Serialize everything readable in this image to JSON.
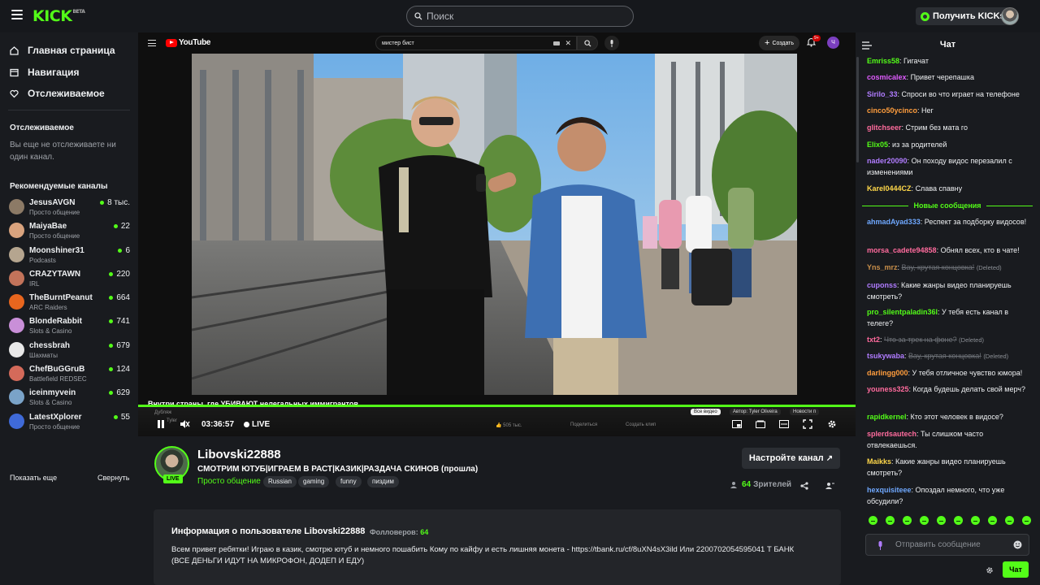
{
  "topbar": {
    "logo": "KICK",
    "logo_badge": "BETA",
    "search_placeholder": "Поиск",
    "get_kicks": "Получить KICKs"
  },
  "sidebar": {
    "nav": [
      {
        "label": "Главная страница",
        "icon": "home-icon"
      },
      {
        "label": "Навигация",
        "icon": "browse-icon"
      },
      {
        "label": "Отслеживаемое",
        "icon": "heart-icon"
      }
    ],
    "following_title": "Отслеживаемое",
    "following_empty": "Вы еще не отслеживаете ни один канал.",
    "recommended_title": "Рекомендуемые каналы",
    "channels": [
      {
        "name": "JesusAVGN",
        "category": "Просто общение",
        "viewers": "8 тыс.",
        "color": "#8c7a66"
      },
      {
        "name": "MaiyaBae",
        "category": "Просто общение",
        "viewers": "22",
        "color": "#d9a37e"
      },
      {
        "name": "Moonshiner31",
        "category": "Podcasts",
        "viewers": "6",
        "color": "#b5a58f"
      },
      {
        "name": "CRAZYTAWN",
        "category": "IRL",
        "viewers": "220",
        "color": "#c2735a"
      },
      {
        "name": "TheBurntPeanut",
        "category": "ARC Raiders",
        "viewers": "664",
        "color": "#e8661e"
      },
      {
        "name": "BlondeRabbit",
        "category": "Slots & Casino",
        "viewers": "741",
        "color": "#c98fd8"
      },
      {
        "name": "chessbrah",
        "category": "Шахматы",
        "viewers": "679",
        "color": "#e8e8e8"
      },
      {
        "name": "ChefBuGGruB",
        "category": "Battlefield REDSEC",
        "viewers": "124",
        "color": "#d46a5a"
      },
      {
        "name": "iceinmyvein",
        "category": "Slots & Casino",
        "viewers": "629",
        "color": "#7aa3c8"
      },
      {
        "name": "LatestXplorer",
        "category": "Просто общение",
        "viewers": "55",
        "color": "#3f6ad8"
      }
    ],
    "show_more": "Показать еще",
    "collapse": "Свернуть"
  },
  "youtube": {
    "logo": "YouTube",
    "search_value": "мистер бист",
    "create": "Создать",
    "notif_count": "9+",
    "avatar_letter": "Ч",
    "video_title": "Внутри страны, где УБИВАЮТ нелегальных иммигрантов..."
  },
  "player": {
    "time": "03:36:57",
    "live": "LIVE",
    "ghost_likes": "505 тыс.",
    "ghost_share": "Поделиться",
    "ghost_clip": "Создать клип",
    "ghost_dub": "Дубляж",
    "ghost_author": "Tyler",
    "chips": [
      "Все видео",
      "Автор: Tyler Oliveira",
      "Новости п"
    ]
  },
  "channel": {
    "name": "Libovski22888",
    "live_badge": "LIVE",
    "stream_title": "СМОТРИМ ЮТУБ|ИГРАЕМ В РАСТ|КАЗИК|РАЗДАЧА СКИНОВ (прошла)",
    "category": "Просто общение",
    "tags": [
      "Russian",
      "gaming",
      "funny",
      "пиздим"
    ],
    "setup_button": "Настройте канал",
    "viewers_count": "64",
    "viewers_label": "Зрителей"
  },
  "about": {
    "heading": "Информация о пользователе Libovski22888",
    "followers_label": "Фолловеров:",
    "followers_count": "64",
    "description": "Всем привет ребятки! Играю в казик, смотрю ютуб и немного пошабить Кому по кайфу и есть лишняя монета - https://tbank.ru/cf/8uXN4sX3ild Или 2200702054595041 Т БАНК (ВСЕ ДЕНЬГИ ИДУТ НА МИКРОФОН, ДОДЕП И ЕДУ)"
  },
  "chat": {
    "title": "Чат",
    "new_messages": "Новые сообщения",
    "deleted_label": "(Deleted)",
    "messages": [
      {
        "user": "Emriss58",
        "color": "#53fc18",
        "text": "Гигачат"
      },
      {
        "user": "cosmicalex",
        "color": "#e05cff",
        "text": "Привет черепашка"
      },
      {
        "user": "Sirilo_33",
        "color": "#b07cff",
        "text": "Спроси во что играет на телефоне"
      },
      {
        "user": "cinco50ycinco",
        "color": "#ff9d3d",
        "text": "Нег"
      },
      {
        "user": "glitchseer",
        "color": "#ff6b9d",
        "text": "Стрим без мата го"
      },
      {
        "user": "Elix05",
        "color": "#53fc18",
        "text": "из за родителей"
      },
      {
        "user": "nader20090",
        "color": "#b07cff",
        "text": "Он походу видос перезалил с изменениями"
      },
      {
        "user": "Karel0444CZ",
        "color": "#ffd84a",
        "text": "Слава спавну"
      },
      {
        "user": "ahmadAyad333",
        "color": "#6fa8ff",
        "text": "Респект за подборку видосов!"
      },
      {
        "user": "morsa_cadete94858",
        "color": "#ff6b9d",
        "text": "Обнял всех, кто в чате!"
      },
      {
        "user": "Yns_mrz",
        "color": "#c98f4a",
        "text": "Вау, крутая концовка!",
        "deleted": true
      },
      {
        "user": "cuponss",
        "color": "#b07cff",
        "text": "Какие жанры видео планируешь смотреть?"
      },
      {
        "user": "pro_silentpaladin36l",
        "color": "#53fc18",
        "text": "У тебя есть канал в телеге?"
      },
      {
        "user": "txt2",
        "color": "#ff6b9d",
        "text": "Что за трек на фоне?",
        "deleted": true
      },
      {
        "user": "tsukywaba",
        "color": "#b07cff",
        "text": "Вау, крутая концовка!",
        "deleted": true
      },
      {
        "user": "darlingg000",
        "color": "#ff9d3d",
        "text": "У тебя отличное чувство юмора!"
      },
      {
        "user": "youness325",
        "color": "#ff6b9d",
        "text": "Когда будешь делать свой мерч?"
      },
      {
        "user": "rapidkernel",
        "color": "#53fc18",
        "text": "Кто этот человек в видосе?"
      },
      {
        "user": "splerdsautech",
        "color": "#ff6b9d",
        "text": "Ты слишком часто отвлекаешься."
      },
      {
        "user": "Maikks",
        "color": "#ffd84a",
        "text": "Какие жанры видео планируешь смотреть?"
      },
      {
        "user": "hexquisiteee",
        "color": "#6fa8ff",
        "text": "Опоздал немного, что уже обсудили?"
      }
    ],
    "input_placeholder": "Отправить сообщение",
    "send": "Чат"
  }
}
